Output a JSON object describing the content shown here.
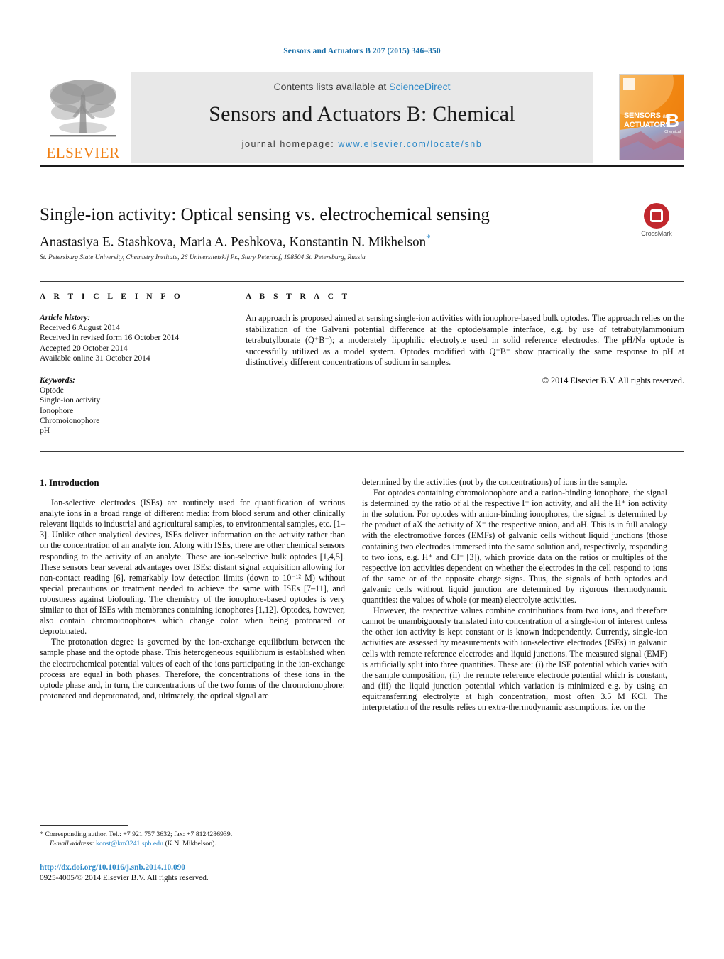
{
  "running_head": "Sensors and Actuators B 207 (2015) 346–350",
  "masthead": {
    "contents_prefix": "Contents lists available at ",
    "sciencedirect": "ScienceDirect",
    "journal_title": "Sensors and Actuators B: Chemical",
    "homepage_label": "journal homepage:",
    "homepage_url": "www.elsevier.com/locate/snb",
    "publisher_logo_text": "ELSEVIER",
    "cover_line1": "SENSORS",
    "cover_and": "and",
    "cover_line2": "ACTUATORS",
    "cover_volume": "B",
    "cover_subject": "Chemical"
  },
  "article": {
    "title": "Single-ion activity: Optical sensing vs. electrochemical sensing",
    "authors": "Anastasiya E. Stashkova, Maria A. Peshkova, Konstantin N. Mikhelson",
    "corresponding_mark": "*",
    "affiliation": "St. Petersburg State University, Chemistry Institute, 26 Universitetskij Pr., Stary Peterhof, 198504 St. Petersburg, Russia"
  },
  "crossmark": {
    "label": "CrossMark"
  },
  "info": {
    "heading": "A R T I C L E   I N F O",
    "history_label": "Article history:",
    "history": [
      "Received 6 August 2014",
      "Received in revised form 16 October 2014",
      "Accepted 20 October 2014",
      "Available online 31 October 2014"
    ],
    "keywords_label": "Keywords:",
    "keywords": [
      "Optode",
      "Single-ion activity",
      "Ionophore",
      "Chromoionophore",
      "pH"
    ]
  },
  "abstract": {
    "heading": "A B S T R A C T",
    "text": "An approach is proposed aimed at sensing single-ion activities with ionophore-based bulk optodes. The approach relies on the stabilization of the Galvani potential difference at the optode/sample interface, e.g. by use of tetrabutylammonium tetrabutylborate (Q⁺B⁻); a moderately lipophilic electrolyte used in solid reference electrodes. The pH/Na optode is successfully utilized as a model system. Optodes modified with Q⁺B⁻ show practically the same response to pH at distinctively different concentrations of sodium in samples.",
    "copyright": "© 2014 Elsevier B.V. All rights reserved."
  },
  "body": {
    "section_number_title": "1.  Introduction",
    "left_paragraphs": [
      "Ion-selective electrodes (ISEs) are routinely used for quantification of various analyte ions in a broad range of different media: from blood serum and other clinically relevant liquids to industrial and agricultural samples, to environmental samples, etc. [1–3]. Unlike other analytical devices, ISEs deliver information on the activity rather than on the concentration of an analyte ion. Along with ISEs, there are other chemical sensors responding to the activity of an analyte. These are ion-selective bulk optodes [1,4,5]. These sensors bear several advantages over ISEs: distant signal acquisition allowing for non-contact reading [6], remarkably low detection limits (down to 10⁻¹² M) without special precautions or treatment needed to achieve the same with ISEs [7–11], and robustness against biofouling. The chemistry of the ionophore-based optodes is very similar to that of ISEs with membranes containing ionophores [1,12]. Optodes, however, also contain chromoionophores which change color when being protonated or deprotonated.",
      "The protonation degree is governed by the ion-exchange equilibrium between the sample phase and the optode phase. This heterogeneous equilibrium is established when the electrochemical potential values of each of the ions participating in the ion-exchange process are equal in both phases. Therefore, the concentrations of these ions in the optode phase and, in turn, the concentrations of the two forms of the chromoionophore: protonated and deprotonated, and, ultimately, the optical signal are"
    ],
    "right_paragraphs": [
      "determined by the activities (not by the concentrations) of ions in the sample.",
      "For optodes containing chromoionophore and a cation-binding ionophore, the signal is determined by the ratio of aI the respective I⁺ ion activity, and aH the H⁺ ion activity in the solution. For optodes with anion-binding ionophores, the signal is determined by the product of aX the activity of X⁻ the respective anion, and aH. This is in full analogy with the electromotive forces (EMFs) of galvanic cells without liquid junctions (those containing two electrodes immersed into the same solution and, respectively, responding to two ions, e.g. H⁺ and Cl⁻ [3]), which provide data on the ratios or multiples of the respective ion activities dependent on whether the electrodes in the cell respond to ions of the same or of the opposite charge signs. Thus, the signals of both optodes and galvanic cells without liquid junction are determined by rigorous thermodynamic quantities: the values of whole (or mean) electrolyte activities.",
      "However, the respective values combine contributions from two ions, and therefore cannot be unambiguously translated into concentration of a single-ion of interest unless the other ion activity is kept constant or is known independently. Currently, single-ion activities are assessed by measurements with ion-selective electrodes (ISEs) in galvanic cells with remote reference electrodes and liquid junctions. The measured signal (EMF) is artificially split into three quantities. These are: (i) the ISE potential which varies with the sample composition, (ii) the remote reference electrode potential which is constant, and (iii) the liquid junction potential which variation is minimized e.g. by using an equitransferring electrolyte at high concentration, most often 3.5 M KCl. The interpretation of the results relies on extra-thermodynamic assumptions, i.e. on the"
    ]
  },
  "footer": {
    "corresponding_mark": "*",
    "corresponding_text": "Corresponding author. Tel.: +7 921 757 3632; fax: +7 8124286939.",
    "email_label": "E-mail address:",
    "email": "konst@km3241.spb.edu",
    "email_owner": "(K.N. Mikhelson).",
    "doi": "http://dx.doi.org/10.1016/j.snb.2014.10.090",
    "issn_line": "0925-4005/© 2014 Elsevier B.V. All rights reserved."
  },
  "colors": {
    "link": "#2d89c8",
    "elsevier_orange": "#f07f13",
    "crossmark_red": "#c1272d",
    "band_gray": "#e8e8e8"
  }
}
